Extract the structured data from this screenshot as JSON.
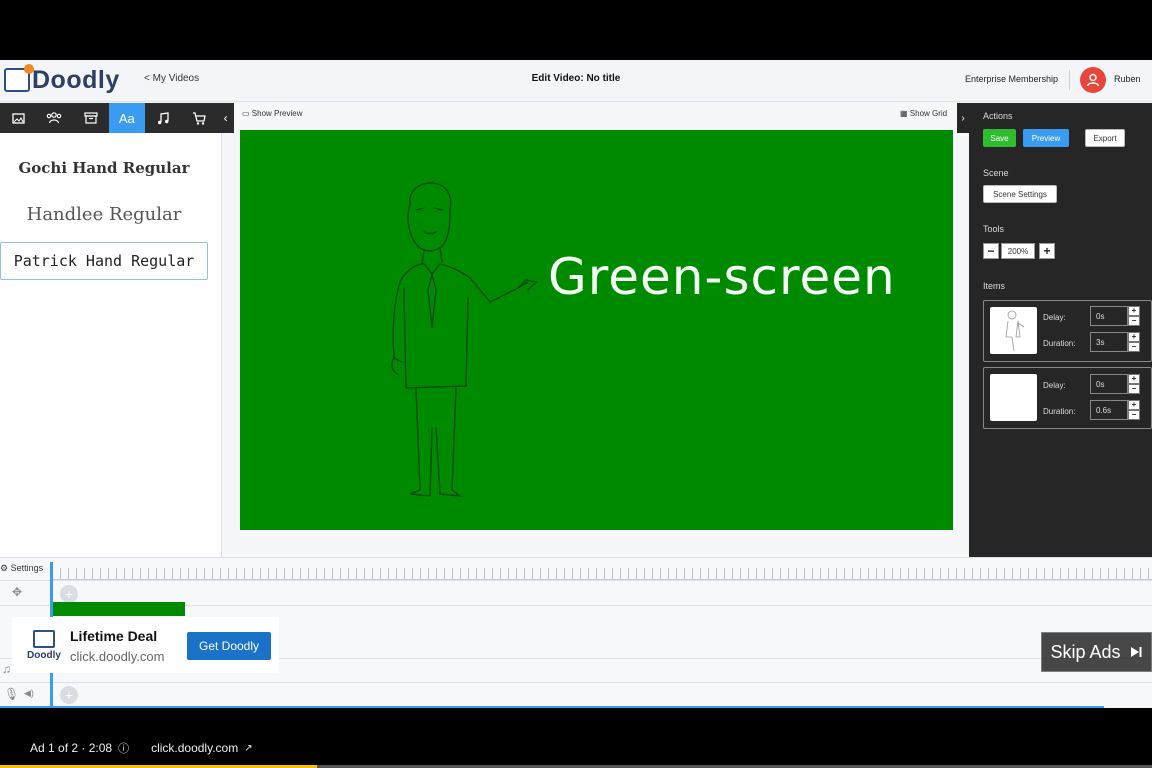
{
  "app": {
    "logo_text": "Doodly",
    "back_link": "< My Videos",
    "edit_title": "Edit Video: No title",
    "membership": "Enterprise Membership",
    "username": "Ruben"
  },
  "left_toolbar": {
    "icons": [
      "image-icon",
      "characters-icon",
      "props-icon",
      "text-icon",
      "music-icon",
      "cart-icon"
    ],
    "text_tab_label": "Aa",
    "active": "text-icon"
  },
  "fonts": [
    {
      "label": "Gochi Hand Regular"
    },
    {
      "label": "Handlee Regular"
    },
    {
      "label": "Patrick Hand Regular",
      "selected": true
    }
  ],
  "canvas": {
    "show_preview": "Show Preview",
    "show_grid": "Show Grid",
    "text": "Green-screen",
    "background": "#008a00"
  },
  "right_panel": {
    "actions_label": "Actions",
    "save": "Save",
    "preview": "Preview",
    "export": "Export",
    "scene_label": "Scene",
    "scene_settings": "Scene Settings",
    "tools_label": "Tools",
    "zoom": "200%",
    "items_label": "Items",
    "delay_label": "Delay:",
    "duration_label": "Duration:",
    "items": [
      {
        "delay": "0s",
        "duration": "3s"
      },
      {
        "delay": "0s",
        "duration": "0.6s"
      }
    ]
  },
  "timeline": {
    "settings_label": "Settings"
  },
  "ad": {
    "logo_text": "Doodly",
    "title": "Lifetime Deal",
    "url": "click.doodly.com",
    "cta": "Get Doodly",
    "skip": "Skip Ads",
    "info": "Ad 1 of 2 · 2:08",
    "info_link": "click.doodly.com",
    "progress": 0.275
  }
}
